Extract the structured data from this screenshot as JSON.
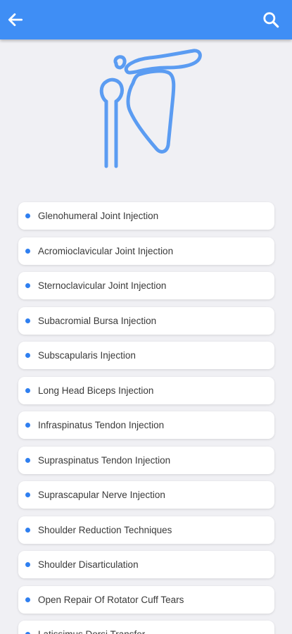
{
  "appbar": {
    "back_icon": "arrow-left-icon",
    "search_icon": "search-icon",
    "color": "#3f8ef5"
  },
  "hero": {
    "icon": "shoulder-joint-icon",
    "color": "#5b9cf2"
  },
  "procedures": [
    {
      "label": "Glenohumeral Joint Injection"
    },
    {
      "label": "Acromioclavicular Joint Injection"
    },
    {
      "label": "Sternoclavicular Joint Injection"
    },
    {
      "label": "Subacromial Bursa Injection"
    },
    {
      "label": "Subscapularis Injection"
    },
    {
      "label": "Long Head Biceps Injection"
    },
    {
      "label": "Infraspinatus Tendon Injection"
    },
    {
      "label": "Supraspinatus Tendon Injection"
    },
    {
      "label": "Suprascapular Nerve Injection"
    },
    {
      "label": "Shoulder Reduction Techniques"
    },
    {
      "label": "Shoulder Disarticulation"
    },
    {
      "label": "Open Repair Of Rotator Cuff Tears"
    },
    {
      "label": "Latissimus Dorsi Transfer"
    }
  ]
}
